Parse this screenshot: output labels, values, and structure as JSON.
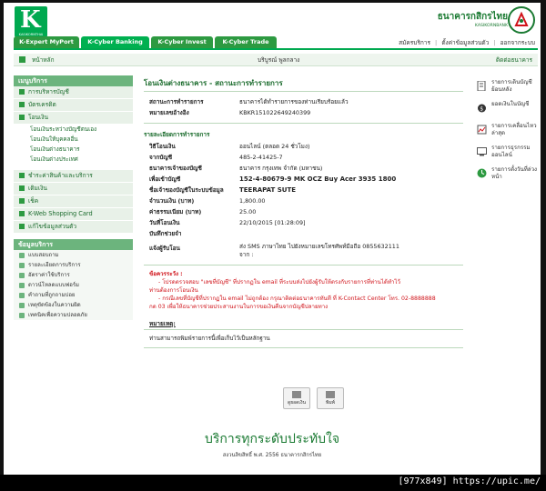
{
  "header": {
    "logo_text": "KASIKORNTHAI",
    "bank_name_th": "ธนาคารกสิกรไทย",
    "bank_name_en": "KASIKORNBANK"
  },
  "tabs": [
    {
      "label": "K-Expert MyPort"
    },
    {
      "label": "K-Cyber Banking"
    },
    {
      "label": "K-Cyber Invest"
    },
    {
      "label": "K-Cyber Trade"
    }
  ],
  "toplinks": [
    "สมัครบริการ",
    "ตั้งค่าข้อมูลส่วนตัว",
    "ออกจากระบบ"
  ],
  "crumb": {
    "home": "หน้าหลัก",
    "user": "บริบูรณ์ พูลกลาง",
    "contact": "ติดต่อธนาคาร"
  },
  "sidebar": {
    "menu_title": "เมนูบริการ",
    "items": [
      {
        "label": "การบริหารบัญชี"
      },
      {
        "label": "บัตรเครดิต"
      },
      {
        "label": "โอนเงิน"
      }
    ],
    "subitems": [
      {
        "label": "โอนเงินระหว่างบัญชีตนเอง"
      },
      {
        "label": "โอนเงินให้บุคคลอื่น"
      },
      {
        "label": "โอนเงินต่างธนาคาร"
      },
      {
        "label": "โอนเงินต่างประเทศ"
      }
    ],
    "items2": [
      {
        "label": "ชำระค่าสินค้าและบริการ"
      },
      {
        "label": "เติมเงิน"
      },
      {
        "label": "เช็ค"
      },
      {
        "label": "K-Web Shopping Card"
      },
      {
        "label": "แก้ไขข้อมูลส่วนตัว"
      }
    ],
    "info_title": "ข้อมูลบริการ",
    "info_items": [
      {
        "label": "แบบสอบถาม"
      },
      {
        "label": "รายละเอียดการบริการ"
      },
      {
        "label": "อัตราค่าใช้บริการ"
      },
      {
        "label": "ดาวน์โหลดแบบฟอร์ม"
      },
      {
        "label": "คำถามที่ถูกถามบ่อย"
      },
      {
        "label": "เหตุขัดข้องในความผิด"
      },
      {
        "label": "เทคนิคเพื่อความปลอดภัย"
      }
    ]
  },
  "main": {
    "title": "โอนเงินต่างธนาคาร - สถานะการทำรายการ",
    "status_label": "สถานะการทำรายการ",
    "status_value": "ธนาคารได้ทำรายการของท่านเรียบร้อยแล้ว",
    "ref_label": "หมายเลขอ้างอิง",
    "ref_value": "KBKR151022649240399",
    "detail_title": "รายละเอียดการทำรายการ",
    "rows": [
      {
        "label": "วิธีโอนเงิน",
        "value": "ออนไลน์ (ตลอด 24 ชั่วโมง)",
        "bold": false
      },
      {
        "label": "จากบัญชี",
        "value": "485-2-41425-7",
        "bold": false
      },
      {
        "label": "ธนาคารเจ้าของบัญชี",
        "value": "ธนาคาร กรุงเทพ จำกัด (มหาชน)",
        "bold": false
      },
      {
        "label": "เพื่อเข้าบัญชี",
        "value": "152-4-80679-9 MK OCZ Buy Acer 3935 1800",
        "bold": true
      },
      {
        "label": "ชื่อเจ้าของบัญชีในระบบข้อมูล",
        "value": "TEERAPAT SUTE",
        "bold": true
      },
      {
        "label": "จำนวนเงิน (บาท)",
        "value": "1,800.00",
        "bold": false
      },
      {
        "label": "ค่าธรรมเนียม (บาท)",
        "value": "25.00",
        "bold": false
      },
      {
        "label": "วันที่โอนเงิน",
        "value": "22/10/2015 [01:28:09]",
        "bold": false
      },
      {
        "label": "บันทึกช่วยจำ",
        "value": "",
        "bold": false
      }
    ],
    "notify_label": "แจ้งผู้รับโอน",
    "notify_value_line1": "ส่ง SMS ภาษาไทย ไปยังหมายเลขโทรศัพท์มือถือ 0855632111",
    "notify_value_line2": "จาก :",
    "caution_title": "ข้อควรระวัง :",
    "caution_lines": [
      "- โปรดตรวจสอบ \"เลขที่บัญชี\" ที่ปรากฏใน email ที่ระบบส่งไปยังผู้รับให้ตรงกับรายการที่ท่านได้ทำไว้",
      "ท่านต้องการโอนเงิน",
      "- กรณีเลขที่บัญชีที่ปรากฏใน email ไม่ถูกต้อง กรุณาติดต่อธนาคารทันที ที่ K-Contact Center โทร. 02-8888888",
      "กด 03 เพื่อให้ธนาคารช่วยประสานงานในการขอเงินคืนจากบัญชีปลายทาง"
    ],
    "remark_title": "หมายเหตุ:",
    "remark_text": "ท่านสามารถพิมพ์รายการนี้เพื่อเก็บไว้เป็นหลักฐาน"
  },
  "rightlinks": [
    {
      "label": "รายการเดินบัญชีย้อนหลัง",
      "icon": "statement-icon"
    },
    {
      "label": "ยอดเงินในบัญชี",
      "icon": "balance-icon"
    },
    {
      "label": "รายการเคลื่อนไหวล่าสุด",
      "icon": "recent-icon"
    },
    {
      "label": "รายการธุรกรรมออนไลน์",
      "icon": "transaction-icon"
    },
    {
      "label": "รายการตั้งวันที่ล่วงหน้า",
      "icon": "clock-icon"
    }
  ],
  "buttons": [
    {
      "label": "ดูยอดเงิน"
    },
    {
      "label": "พิมพ์"
    }
  ],
  "footer": {
    "slogan": "บริการทุกระดับประทับใจ",
    "copyright": "สงวนลิขสิทธิ์ พ.ศ. 2556 ธนาคารกสิกรไทย"
  },
  "watermark": "[977x849] https://upic.me/"
}
